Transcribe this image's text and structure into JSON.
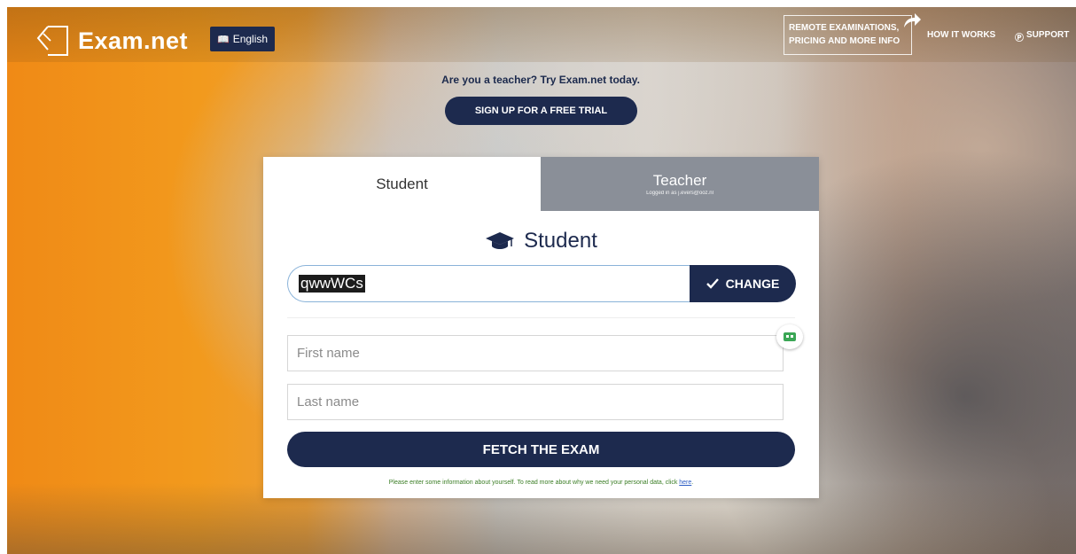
{
  "header": {
    "logo_text": "Exam.net",
    "language_label": "English",
    "remote_line1": "REMOTE EXAMINATIONS,",
    "remote_line2": "PRICING AND MORE INFO",
    "how_it_works": "HOW IT WORKS",
    "support": "SUPPORT"
  },
  "promo": {
    "text": "Are you a teacher? Try Exam.net today.",
    "signup_label": "SIGN UP FOR A FREE TRIAL"
  },
  "tabs": {
    "student": "Student",
    "teacher": "Teacher",
    "teacher_sub": "Logged in as j.evers@ooz.nl"
  },
  "form": {
    "heading": "Student",
    "exam_code_value": "qwwWCs",
    "change_label": "CHANGE",
    "first_name_placeholder": "First name",
    "last_name_placeholder": "Last name",
    "fetch_label": "FETCH THE EXAM",
    "note_text": "Please enter some information about yourself. To read more about why we need your personal data, click ",
    "note_link": "here",
    "note_end": "."
  },
  "colors": {
    "navy": "#1d2a4e",
    "teacher_tab": "#8a8f98",
    "note_green": "#3a7d24"
  }
}
